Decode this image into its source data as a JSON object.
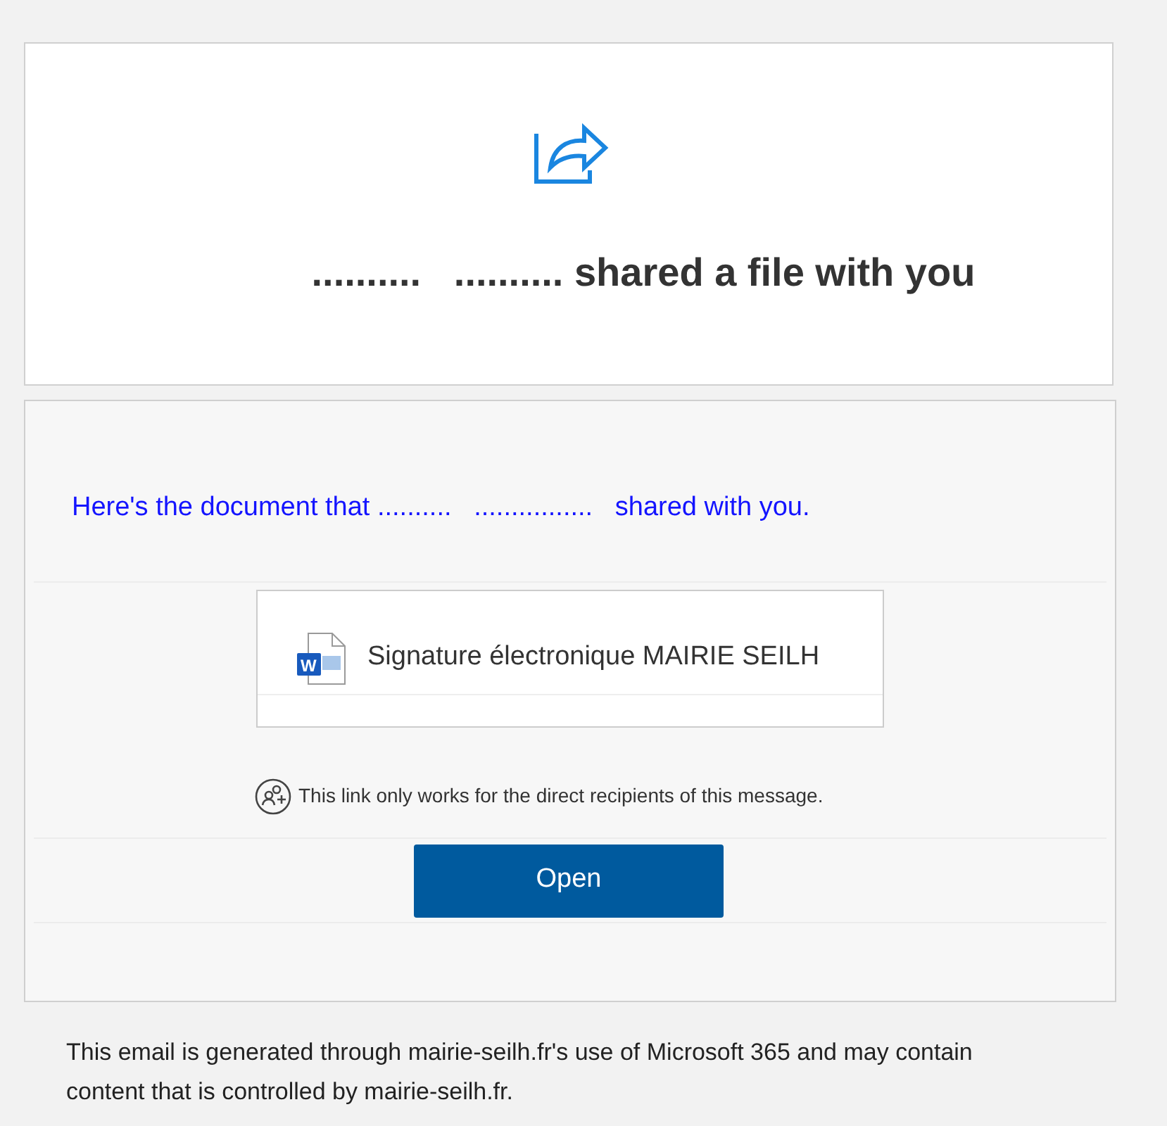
{
  "header": {
    "title": "..........   .......... shared a file with you"
  },
  "body": {
    "message": "Here's the document that ..........   ................   shared with you.",
    "file": {
      "icon_letter": "W",
      "name": "Signature électronique MAIRIE SEILH"
    },
    "notice": "This link only works for the direct recipients of this message.",
    "button": "Open"
  },
  "footer": "This email is generated through mairie-seilh.fr's use of Microsoft 365 and may contain content that is controlled by mairie-seilh.fr."
}
